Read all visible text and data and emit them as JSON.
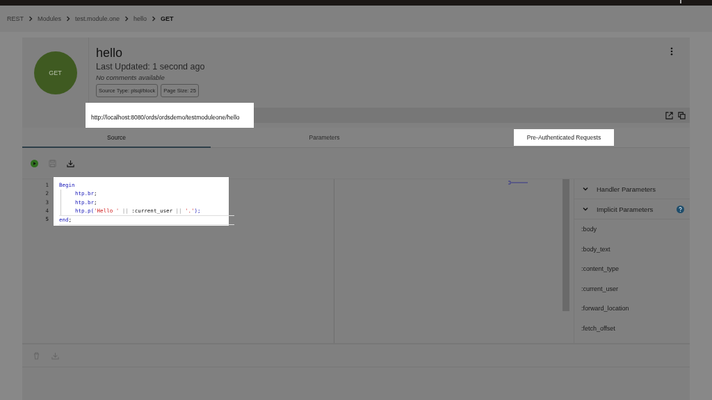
{
  "breadcrumb": [
    {
      "label": "REST",
      "current": false
    },
    {
      "label": "Modules",
      "current": false
    },
    {
      "label": "test.module.one",
      "current": false
    },
    {
      "label": "hello",
      "current": false
    },
    {
      "label": "GET",
      "current": true
    }
  ],
  "handler": {
    "method": "GET",
    "title": "hello",
    "updated": "Last Updated: 1 second ago",
    "comments": "No comments available",
    "chips": [
      "Source Type: plsql/block",
      "Page Size: 25"
    ]
  },
  "url": {
    "value": "http://localhost:8080/ords/ordsdemo/testmoduleone/hello",
    "highlighted": true
  },
  "tabs": [
    {
      "label": "Source",
      "selected": true,
      "highlighted": false
    },
    {
      "label": "Parameters",
      "selected": false,
      "highlighted": false
    },
    {
      "label": "Pre-Authenticated Requests",
      "selected": false,
      "highlighted": true
    }
  ],
  "editor": {
    "highlighted": true,
    "lines": [
      {
        "number": "1",
        "indented": false,
        "active": false,
        "tokens": [
          {
            "text": "Begin",
            "kind": "keyword"
          }
        ]
      },
      {
        "number": "2",
        "indented": true,
        "active": false,
        "tokens": [
          {
            "text": "htp.br",
            "kind": "keyword"
          },
          {
            "text": ";",
            "kind": "plain"
          }
        ]
      },
      {
        "number": "3",
        "indented": true,
        "active": false,
        "tokens": [
          {
            "text": "htp.br",
            "kind": "keyword"
          },
          {
            "text": ";",
            "kind": "plain"
          }
        ]
      },
      {
        "number": "4",
        "indented": true,
        "active": false,
        "tokens": [
          {
            "text": "htp.p(",
            "kind": "keyword"
          },
          {
            "text": "'Hello '",
            "kind": "string"
          },
          {
            "text": " || ",
            "kind": "operator"
          },
          {
            "text": ":current_user",
            "kind": "plain"
          },
          {
            "text": " || ",
            "kind": "operator"
          },
          {
            "text": "'.'",
            "kind": "string"
          },
          {
            "text": ");",
            "kind": "keyword"
          }
        ]
      },
      {
        "number": "5",
        "indented": false,
        "active": true,
        "tokens": [
          {
            "text": "end",
            "kind": "keyword"
          },
          {
            "text": ";",
            "kind": "plain"
          }
        ]
      }
    ]
  },
  "parameters": {
    "sections": [
      {
        "label": "Handler Parameters",
        "help": false
      },
      {
        "label": "Implicit Parameters",
        "help": true
      }
    ],
    "items": [
      ":body",
      ":body_text",
      ":content_type",
      ":current_user",
      ":forward_location",
      ":fetch_offset"
    ]
  }
}
